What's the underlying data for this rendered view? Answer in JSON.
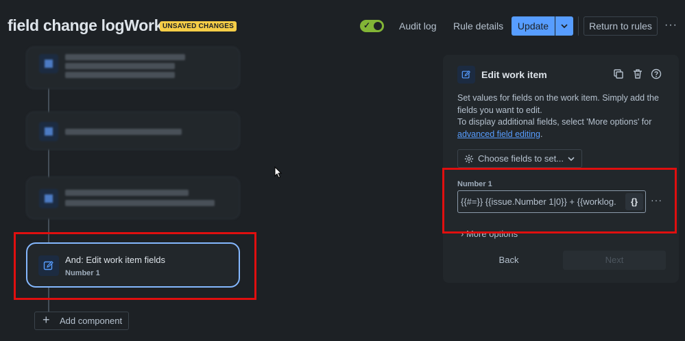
{
  "header": {
    "title": "field change logWork",
    "badge": "UNSAVED CHANGES",
    "toggle_on": true,
    "audit_log": "Audit log",
    "rule_details": "Rule details",
    "update": "Update",
    "return_to_rules": "Return to rules",
    "more": "···"
  },
  "flow": {
    "selected_component": {
      "title": "And: Edit work item fields",
      "subtitle": "Number 1"
    },
    "add_component": "Add component"
  },
  "panel": {
    "title": "Edit work item",
    "description_line1": "Set values for fields on the work item. Simply add the fields you want to edit.",
    "description_line2": "To display additional fields, select 'More options' for ",
    "description_link": "advanced field editing",
    "description_end": ".",
    "choose_fields": "Choose fields to set...",
    "field_label": "Number 1",
    "field_value": "{{#=}} {{issue.Number 1|0}} + {{worklog.",
    "insert_smart_value": "{}",
    "field_more": "···",
    "more_options": "More options",
    "back": "Back",
    "next": "Next"
  },
  "colors": {
    "background": "#1d2125",
    "accent": "#579dff",
    "badge": "#f5cd47",
    "toggle": "#82b536",
    "highlight": "#e00f0f"
  }
}
